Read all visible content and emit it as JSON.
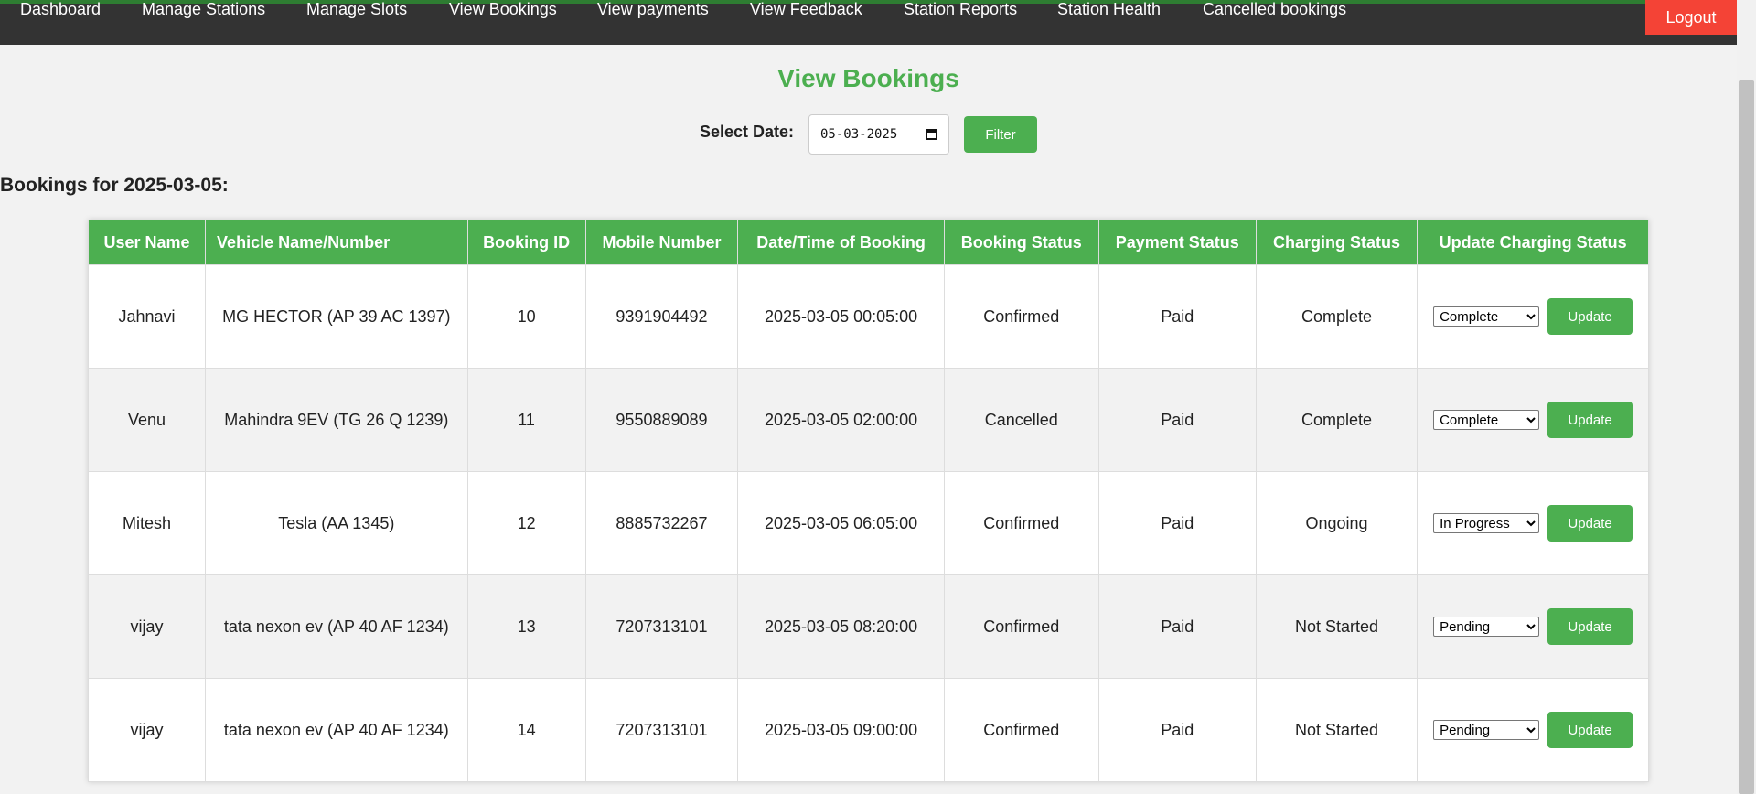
{
  "nav": {
    "items": [
      {
        "label": "Dashboard"
      },
      {
        "label": "Manage Stations"
      },
      {
        "label": "Manage Slots"
      },
      {
        "label": "View Bookings"
      },
      {
        "label": "View payments"
      },
      {
        "label": "View Feedback"
      },
      {
        "label": "Station Reports"
      },
      {
        "label": "Station Health"
      },
      {
        "label": "Cancelled bookings"
      }
    ],
    "logout_label": "Logout"
  },
  "page": {
    "title": "View Bookings"
  },
  "filter": {
    "label": "Select Date:",
    "date_display": "05-03-2025",
    "button_label": "Filter"
  },
  "bookings_heading": "Bookings for 2025-03-05:",
  "table": {
    "headers": [
      "User Name",
      "Vehicle Name/Number",
      "Booking ID",
      "Mobile Number",
      "Date/Time of Booking",
      "Booking Status",
      "Payment Status",
      "Charging Status",
      "Update Charging Status"
    ],
    "rows": [
      {
        "user": "Jahnavi",
        "vehicle": "MG HECTOR (AP 39 AC 1397)",
        "id": "10",
        "mobile": "9391904492",
        "datetime": "2025-03-05 00:05:00",
        "booking_status": "Confirmed",
        "payment_status": "Paid",
        "charging_status": "Complete",
        "select_value": "Complete",
        "update_label": "Update"
      },
      {
        "user": "Venu",
        "vehicle": "Mahindra 9EV (TG 26 Q 1239)",
        "id": "11",
        "mobile": "9550889089",
        "datetime": "2025-03-05 02:00:00",
        "booking_status": "Cancelled",
        "payment_status": "Paid",
        "charging_status": "Complete",
        "select_value": "Complete",
        "update_label": "Update"
      },
      {
        "user": "Mitesh",
        "vehicle": "Tesla (AA 1345)",
        "id": "12",
        "mobile": "8885732267",
        "datetime": "2025-03-05 06:05:00",
        "booking_status": "Confirmed",
        "payment_status": "Paid",
        "charging_status": "Ongoing",
        "select_value": "In Progress",
        "update_label": "Update"
      },
      {
        "user": "vijay",
        "vehicle": "tata nexon ev (AP 40 AF 1234)",
        "id": "13",
        "mobile": "7207313101",
        "datetime": "2025-03-05 08:20:00",
        "booking_status": "Confirmed",
        "payment_status": "Paid",
        "charging_status": "Not Started",
        "select_value": "Pending",
        "update_label": "Update"
      },
      {
        "user": "vijay",
        "vehicle": "tata nexon ev (AP 40 AF 1234)",
        "id": "14",
        "mobile": "7207313101",
        "datetime": "2025-03-05 09:00:00",
        "booking_status": "Confirmed",
        "payment_status": "Paid",
        "charging_status": "Not Started",
        "select_value": "Pending",
        "update_label": "Update"
      }
    ]
  },
  "colors": {
    "accent": "#4caf50",
    "nav_bg": "#333333",
    "logout": "#f44336"
  }
}
